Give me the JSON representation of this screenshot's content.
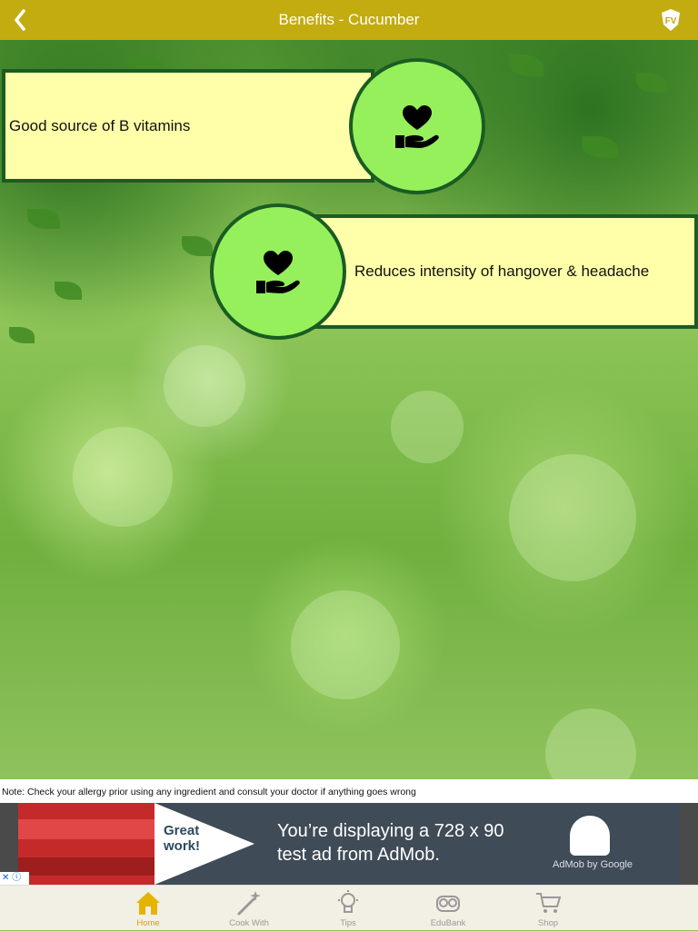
{
  "header": {
    "title": "Benefits - Cucumber",
    "back_icon": "chevron-left-icon",
    "logo_text": "FV"
  },
  "benefits": [
    {
      "label": "Good source of B vitamins",
      "icon": "heart-hand-icon"
    },
    {
      "label": "Reduces intensity of hangover & headache",
      "icon": "heart-hand-icon"
    }
  ],
  "note": "Note: Check your allergy prior using any ingredient and consult your doctor if anything goes wrong",
  "ad": {
    "great_line1": "Great",
    "great_line2": "work!",
    "text_line1": "You’re displaying a 728 x 90",
    "text_line2": "test ad from AdMob.",
    "brand": "AdMob by Google"
  },
  "tabs": [
    {
      "label": "Home",
      "icon": "home-icon",
      "active": true
    },
    {
      "label": "Cook With",
      "icon": "magic-wand-icon",
      "active": false
    },
    {
      "label": "Tips",
      "icon": "lightbulb-icon",
      "active": false
    },
    {
      "label": "EduBank",
      "icon": "owl-icon",
      "active": false
    },
    {
      "label": "Shop",
      "icon": "cart-icon",
      "active": false
    }
  ],
  "colors": {
    "header_bg": "#c2ac10",
    "card_bg": "#ffffaa",
    "circle_bg": "#95f05b",
    "border": "#1a5c22",
    "tab_active": "#d4a300"
  }
}
